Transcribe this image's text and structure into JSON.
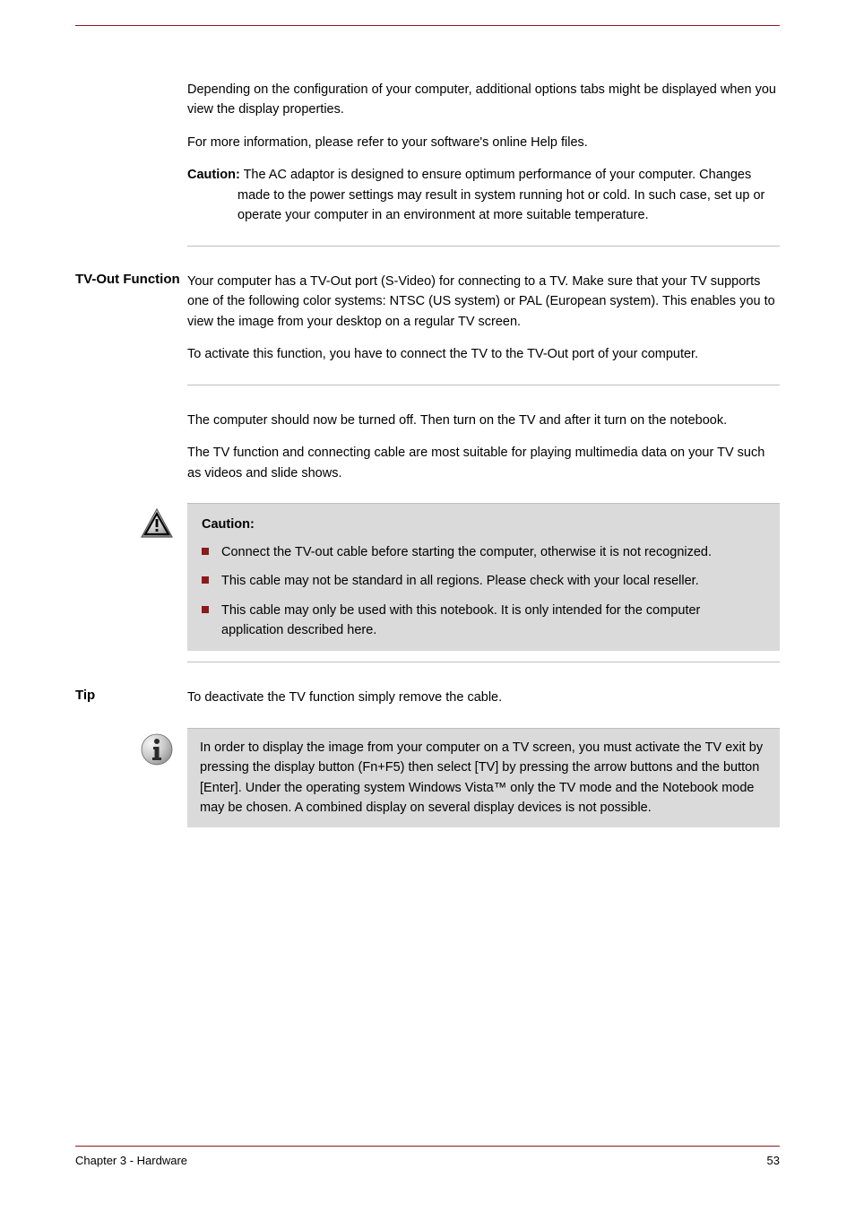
{
  "header": {
    "spacer": ""
  },
  "intro": {
    "para1": "Depending on the configuration of your computer, additional options tabs might be displayed when you view the display properties.",
    "para2": "For more information, please refer to your software's online Help files.",
    "cautionTitle": "Caution:",
    "cautionText": "The AC adaptor is designed to ensure optimum performance of your computer. Changes made to the power settings may result in system running hot or cold. In such case, set up or operate your computer in an environment at more suitable temperature."
  },
  "tvout": {
    "sidehead": "TV-Out Function",
    "para1": "Your computer has a TV-Out port (S-Video) for connecting to a TV. Make sure that your TV supports one of the following color systems: NTSC (US system) or PAL (European system). This enables you to view the image from your desktop on a regular TV screen.",
    "para2": "To activate this function, you have to connect the TV to the TV-Out port of your computer.",
    "para3": "The computer should now be turned off. Then turn on the TV and after it turn on the notebook.",
    "para4": "The TV function and connecting cable are most suitable for playing multimedia data on your TV such as videos and slide shows."
  },
  "caution": {
    "title": "Caution:",
    "items": [
      "Connect the TV-out cable before starting the computer, otherwise it is not recognized.",
      "This cable may not be standard in all regions. Please check with your local reseller.",
      "This cable may only be used with this notebook. It is only intended for the computer application described here."
    ]
  },
  "tip": {
    "sidehead": "Tip",
    "text": "To deactivate the TV function simply remove the cable."
  },
  "resolution": {
    "para": "In order to display the image from your computer on a TV screen, you must activate the TV exit by pressing the display button (Fn+F5) then select [TV] by pressing the arrow buttons and the button [Enter]. Under the operating system Windows Vista™ only the TV mode and the Notebook mode may be chosen. A combined display on several display devices is not possible."
  },
  "footer": {
    "left": "Chapter 3 - Hardware",
    "right": "53"
  }
}
